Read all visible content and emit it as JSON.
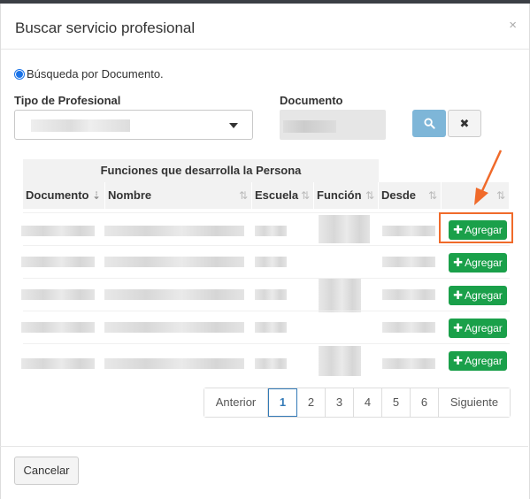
{
  "dialog": {
    "title": "Buscar servicio profesional",
    "close_glyph": "×"
  },
  "search_mode": {
    "label": "Búsqueda por Documento."
  },
  "form": {
    "tipo_label": "Tipo de Profesional",
    "documento_label": "Documento",
    "tipo_value": "",
    "documento_value": ""
  },
  "buttons": {
    "clear": "✖",
    "cancel": "Cancelar",
    "add": "Agregar"
  },
  "table": {
    "group_header": "Funciones que desarrolla la Persona",
    "columns": [
      "Documento",
      "Nombre",
      "Escuela",
      "Función",
      "Desde",
      ""
    ],
    "row_count": 5
  },
  "pagination": {
    "prev": "Anterior",
    "pages": [
      "1",
      "2",
      "3",
      "4",
      "5",
      "6"
    ],
    "next": "Siguiente",
    "current": "1"
  },
  "colors": {
    "add_button": "#1aa04a",
    "search_button": "#7eb6d8",
    "highlight": "#f06a2a",
    "accent": "#337ab7"
  },
  "icons": {
    "search": "search-icon",
    "clear": "times-icon",
    "close": "close-icon",
    "plus": "plus-icon",
    "sort": "sort-icon",
    "dropdown": "caret-down-icon",
    "annotation": "arrow-annotation"
  }
}
